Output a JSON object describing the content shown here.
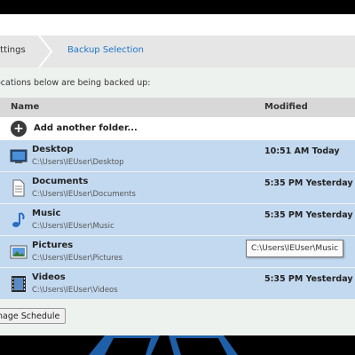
{
  "breadcrumb": {
    "items": [
      "ettings",
      "Backup Selection"
    ]
  },
  "info_text": "ocations below are being backed up:",
  "columns": {
    "name": "Name",
    "modified": "Modified"
  },
  "add_folder_label": "Add another folder...",
  "folders": [
    {
      "name": "Desktop",
      "path": "C:\\Users\\IEUser\\Desktop",
      "modified": "10:51 AM Today",
      "icon": "desktop-icon"
    },
    {
      "name": "Documents",
      "path": "C:\\Users\\IEUser\\Documents",
      "modified": "5:35 PM Yesterday",
      "icon": "document-icon"
    },
    {
      "name": "Music",
      "path": "C:\\Users\\IEUser\\Music",
      "modified": "5:35 PM Yesterday",
      "icon": "music-icon"
    },
    {
      "name": "Pictures",
      "path": "C:\\Users\\IEUser\\Pictures",
      "modified": "",
      "icon": "pictures-icon"
    },
    {
      "name": "Videos",
      "path": "C:\\Users\\IEUser\\Videos",
      "modified": "5:35 PM Yesterday",
      "icon": "videos-icon"
    }
  ],
  "tooltip": "C:\\Users\\IEUser\\Music",
  "schedule_button": "nage Schedule",
  "colors": {
    "accent": "#1d75c9",
    "row_selected": "#c3d9f0",
    "header_bg": "#d8d8d8"
  }
}
